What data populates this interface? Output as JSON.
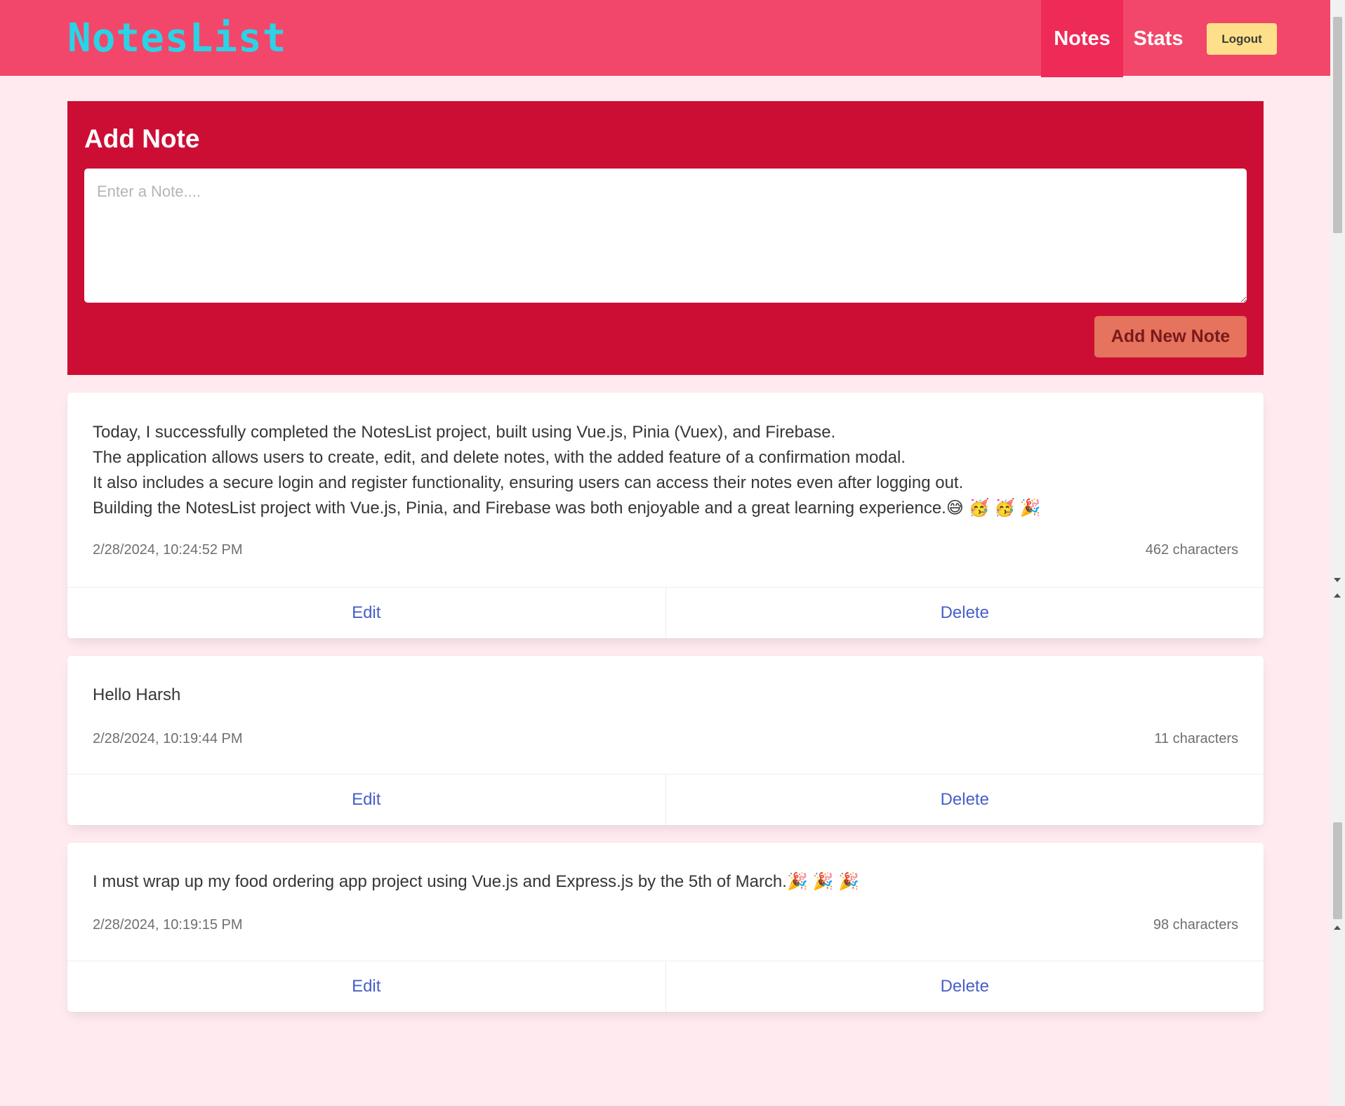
{
  "navbar": {
    "brand": "NotesList",
    "items": [
      {
        "label": "Notes",
        "active": true
      },
      {
        "label": "Stats",
        "active": false
      }
    ],
    "logout_label": "Logout"
  },
  "add_note": {
    "title": "Add Note",
    "placeholder": "Enter a Note....",
    "value": "",
    "button_label": "Add New Note"
  },
  "notes": [
    {
      "lines": [
        "Today, I successfully completed the NotesList project, built using Vue.js, Pinia (Vuex), and Firebase.",
        "The application allows users to create, edit, and delete notes, with the added feature of a confirmation modal.",
        "It also includes a secure login and register functionality, ensuring users can access their notes even after logging out.",
        "Building the NotesList project with Vue.js, Pinia, and Firebase was both enjoyable and a great learning experience.😅 🥳 🥳 🎉"
      ],
      "date": "2/28/2024, 10:24:52 PM",
      "characters": "462 characters",
      "edit_label": "Edit",
      "delete_label": "Delete"
    },
    {
      "lines": [
        "Hello Harsh"
      ],
      "date": "2/28/2024, 10:19:44 PM",
      "characters": "11 characters",
      "edit_label": "Edit",
      "delete_label": "Delete"
    },
    {
      "lines": [
        "I must wrap up my food ordering app project using Vue.js and Express.js by the 5th of March.🎉 🎉 🎉"
      ],
      "date": "2/28/2024, 10:19:15 PM",
      "characters": "98 characters",
      "edit_label": "Edit",
      "delete_label": "Delete"
    }
  ],
  "colors": {
    "background": "#ffebef",
    "navbar": "#f2476a",
    "navbar_active": "#ee2a56",
    "brand": "#2ad3e6",
    "add_panel": "#cc0e34",
    "add_button": "#e5735d",
    "logout_button": "#ffe08a",
    "link": "#485fc7"
  }
}
